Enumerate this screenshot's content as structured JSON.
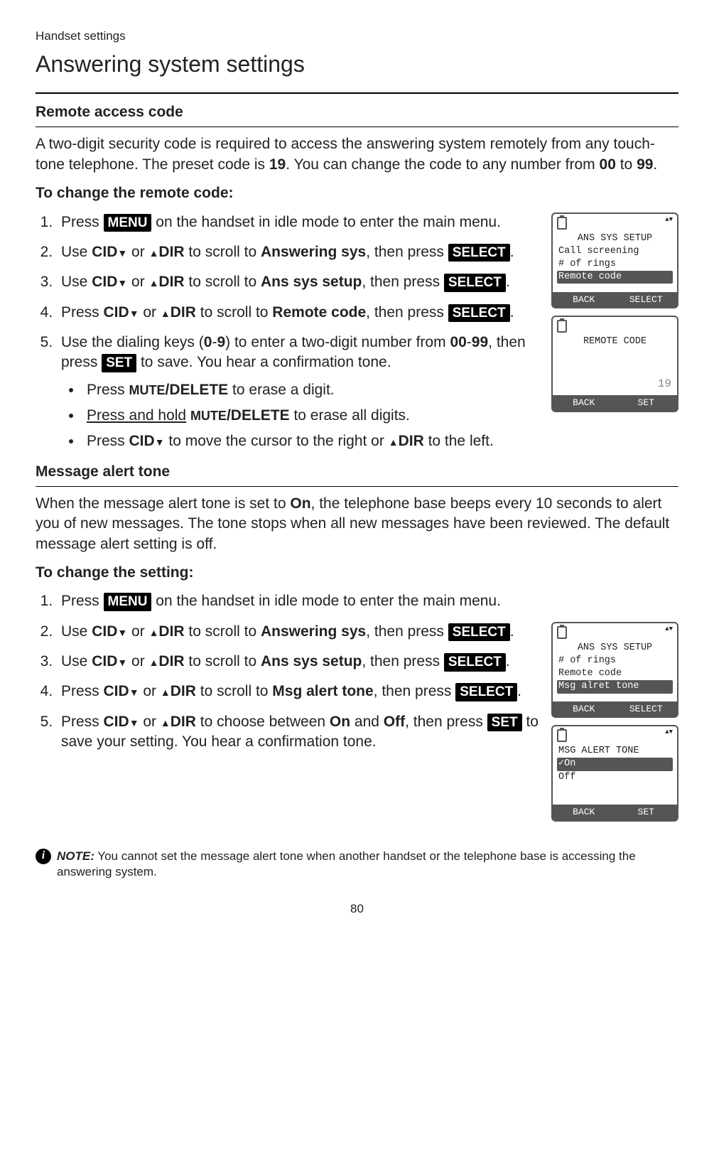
{
  "breadcrumb": "Handset settings",
  "page_title": "Answering system settings",
  "section1": {
    "heading": "Remote access code",
    "intro_parts": [
      "A two-digit security code is required to access the answering system remotely from any touch-tone telephone. The preset code is ",
      "19",
      ". You can change the code to any number from ",
      "00",
      " to ",
      "99",
      "."
    ],
    "subheading": "To change the remote code:",
    "steps": {
      "s1a": "Press ",
      "s1b": " on the handset in idle mode to enter the main menu.",
      "s2a": "Use ",
      "s2b": " or ",
      "s2c": " to scroll to ",
      "s2d": "Answering sys",
      "s2e": ", then press ",
      "s2f": ".",
      "s3a": "Use ",
      "s3b": " or ",
      "s3c": " to scroll to ",
      "s3d": "Ans sys setup",
      "s3e": ", then press ",
      "s3f": ".",
      "s4a": "Press ",
      "s4b": " or ",
      "s4c": " to scroll to ",
      "s4d": "Remote code",
      "s4e": ", then press ",
      "s4f": ".",
      "s5a": "Use the dialing keys (",
      "s5b": "0",
      "s5c": "-",
      "s5d": "9",
      "s5e": ") to enter a two-digit number from ",
      "s5f": "00",
      "s5g": "-",
      "s5h": "99",
      "s5i": ", then press ",
      "s5j": " to save. You hear a confirmation tone."
    },
    "bullets": {
      "b1a": "Press ",
      "b1b": "/DELETE",
      "b1c": " to erase a digit.",
      "b2a": "Press and hold",
      "b2b": " ",
      "b2c": "/DELETE",
      "b2d": " to erase all digits.",
      "b3a": "Press ",
      "b3b": " to move the cursor to the right or ",
      "b3c": " to the left."
    }
  },
  "section2": {
    "heading": "Message alert tone",
    "intro_parts": [
      "When the message alert tone is set to ",
      "On",
      ", the telephone base beeps every 10 seconds to alert you of new messages. The tone stops when all new messages have been reviewed. The default message alert setting is off."
    ],
    "subheading": "To change the setting:",
    "steps": {
      "s1a": "Press ",
      "s1b": " on the handset in idle mode to enter the main menu.",
      "s2a": "Use ",
      "s2b": " or ",
      "s2c": " to scroll to ",
      "s2d": "Answering sys",
      "s2e": ", then press ",
      "s2f": ".",
      "s3a": "Use ",
      "s3b": " or ",
      "s3c": " to scroll to ",
      "s3d": "Ans sys setup",
      "s3e": ", then press ",
      "s3f": ".",
      "s4a": "Press ",
      "s4b": " or ",
      "s4c": " to scroll to ",
      "s4d": "Msg alert tone",
      "s4e": ", then press ",
      "s4f": ".",
      "s5a": "Press ",
      "s5b": " or ",
      "s5c": " to choose between ",
      "s5d": "On",
      "s5e": " and ",
      "s5f": "Off",
      "s5g": ", then press ",
      "s5h": " to save your setting. You hear a confirmation tone."
    }
  },
  "buttons": {
    "menu": "MENU",
    "select": "SELECT",
    "set": "SET",
    "cid": "CID",
    "dir": "DIR",
    "mute": "MUTE"
  },
  "screens": {
    "remote_menu": {
      "title": "ANS SYS SETUP",
      "rows": [
        "Call screening",
        "# of rings",
        "Remote code"
      ],
      "soft_left": "BACK",
      "soft_right": "SELECT"
    },
    "remote_code": {
      "title": "REMOTE CODE",
      "value": "19",
      "soft_left": "BACK",
      "soft_right": "SET"
    },
    "alert_menu": {
      "title": "ANS SYS SETUP",
      "rows": [
        "# of rings",
        "Remote code",
        "Msg alret tone"
      ],
      "soft_left": "BACK",
      "soft_right": "SELECT"
    },
    "alert_tone": {
      "title": "MSG ALERT TONE",
      "rows": [
        "✓On",
        " Off"
      ],
      "soft_left": "BACK",
      "soft_right": "SET"
    }
  },
  "note": {
    "label": "NOTE:",
    "text": " You cannot set the message alert tone when another handset or the telephone base is accessing the answering system."
  },
  "page_number": "80"
}
